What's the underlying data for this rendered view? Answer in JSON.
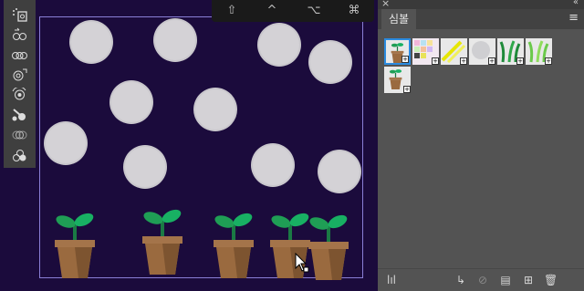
{
  "colors": {
    "canvas_bg": "#1b0b3c",
    "panel_bg": "#535353",
    "accent_selection": "#2b8be0",
    "leaf_green": "#1f9e55",
    "pot_brown": "#9a6a3f"
  },
  "top_bar": {
    "buttons": [
      {
        "name": "shift-key-button",
        "glyph": "⇧"
      },
      {
        "name": "control-key-button",
        "glyph": "^"
      },
      {
        "name": "option-key-button",
        "glyph": "⌥"
      },
      {
        "name": "command-key-button",
        "glyph": "⌘"
      }
    ]
  },
  "panel": {
    "close_glyph": "×",
    "collapse_glyph": "«",
    "tab_label": "심볼",
    "menu_glyph": "≡",
    "bottom_icons": [
      {
        "name": "symbol-libraries-icon",
        "glyph": "lıl"
      },
      {
        "name": "place-symbol-instance-icon",
        "glyph": "↳"
      },
      {
        "name": "break-link-icon",
        "glyph": "⊘"
      },
      {
        "name": "symbol-options-icon",
        "glyph": "▤"
      },
      {
        "name": "new-symbol-icon",
        "glyph": "⊞"
      },
      {
        "name": "delete-symbol-icon",
        "glyph": "🗑"
      }
    ]
  }
}
